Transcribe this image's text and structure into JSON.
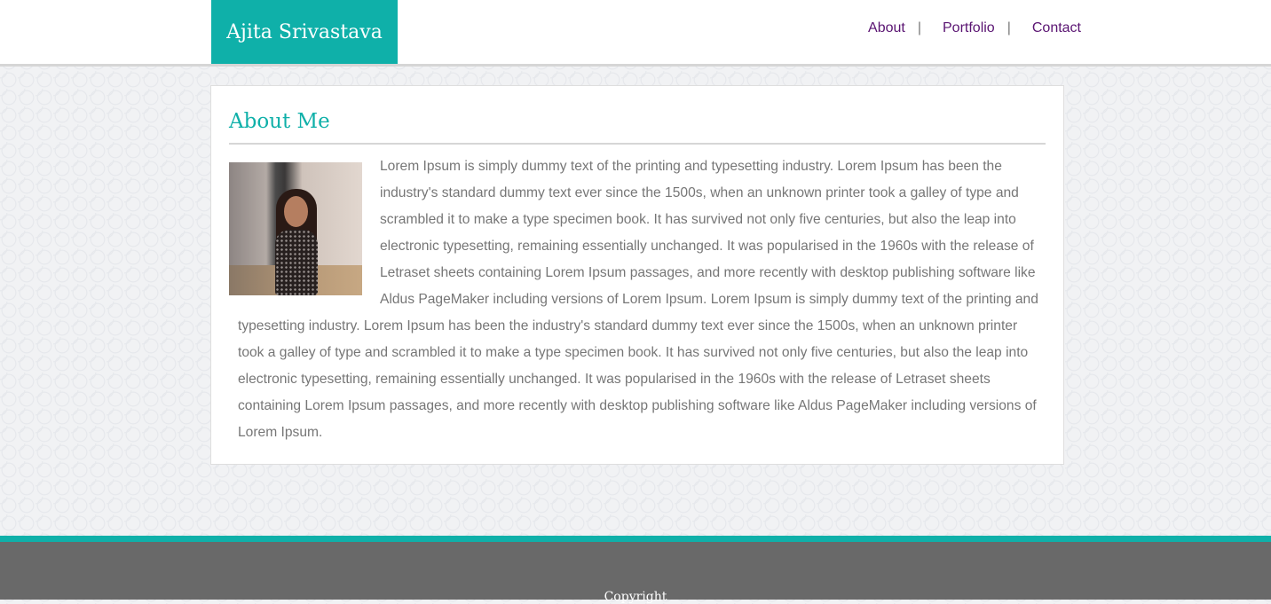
{
  "header": {
    "site_title": "Ajita Srivastava",
    "nav": [
      "About",
      "Portfolio",
      "Contact"
    ],
    "separator": "|"
  },
  "about": {
    "heading": "About Me",
    "paragraph": "Lorem Ipsum is simply dummy text of the printing and typesetting industry. Lorem Ipsum has been the industry's standard dummy text ever since the 1500s, when an unknown printer took a galley of type and scrambled it to make a type specimen book. It has survived not only five centuries, but also the leap into electronic typesetting, remaining essentially unchanged. It was popularised in the 1960s with the release of Letraset sheets containing Lorem Ipsum passages, and more recently with desktop publishing software like Aldus PageMaker including versions of Lorem Ipsum. Lorem Ipsum is simply dummy text of the printing and typesetting industry. Lorem Ipsum has been the industry's standard dummy text ever since the 1500s, when an unknown printer took a galley of type and scrambled it to make a type specimen book. It has survived not only five centuries, but also the leap into electronic typesetting, remaining essentially unchanged. It was popularised in the 1960s with the release of Letraset sheets containing Lorem Ipsum passages, and more recently with desktop publishing software like Aldus PageMaker including versions of Lorem Ipsum."
  },
  "footer": {
    "copyright": "Copyright"
  },
  "colors": {
    "accent": "#0fb0a9",
    "nav_link": "#5a1472",
    "footer_bg": "#696969"
  }
}
